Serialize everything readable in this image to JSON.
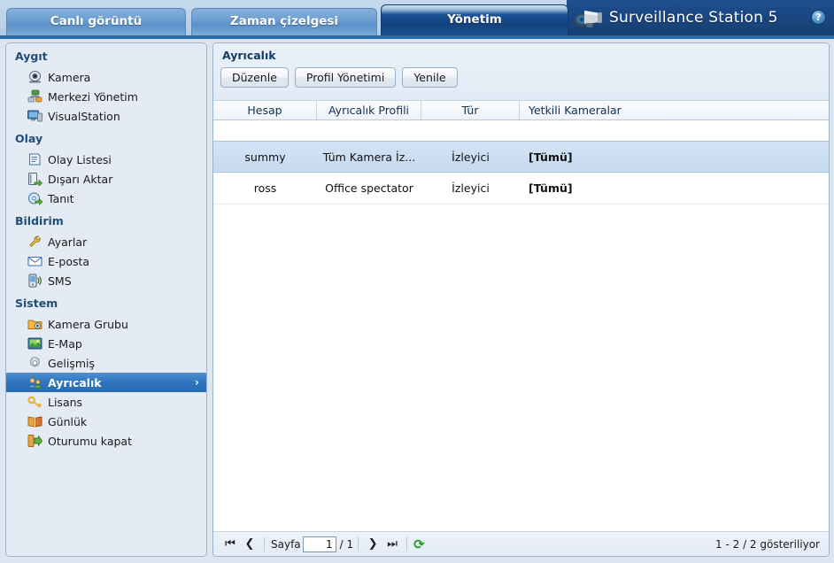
{
  "app": {
    "brand_title": "Surveillance Station 5",
    "help_glyph": "?",
    "logo_icon": "camera-logo-icon"
  },
  "tabs": [
    {
      "id": "live",
      "label": "Canlı görüntü",
      "active": false
    },
    {
      "id": "timeline",
      "label": "Zaman çizelgesi",
      "active": false
    },
    {
      "id": "admin",
      "label": "Yönetim",
      "active": true
    }
  ],
  "sidebar": {
    "groups": [
      {
        "title": "Aygıt",
        "items": [
          {
            "label": "Kamera",
            "icon": "camera-icon",
            "selected": false
          },
          {
            "label": "Merkezi Yönetim",
            "icon": "central-management-icon",
            "selected": false
          },
          {
            "label": "VisualStation",
            "icon": "visualstation-icon",
            "selected": false
          }
        ]
      },
      {
        "title": "Olay",
        "items": [
          {
            "label": "Olay Listesi",
            "icon": "event-list-icon",
            "selected": false
          },
          {
            "label": "Dışarı Aktar",
            "icon": "export-icon",
            "selected": false
          },
          {
            "label": "Tanıt",
            "icon": "mount-icon",
            "selected": false
          }
        ]
      },
      {
        "title": "Bildirim",
        "items": [
          {
            "label": "Ayarlar",
            "icon": "wrench-icon",
            "selected": false
          },
          {
            "label": "E-posta",
            "icon": "envelope-icon",
            "selected": false
          },
          {
            "label": "SMS",
            "icon": "sms-icon",
            "selected": false
          }
        ]
      },
      {
        "title": "Sistem",
        "items": [
          {
            "label": "Kamera Grubu",
            "icon": "camera-group-icon",
            "selected": false
          },
          {
            "label": "E-Map",
            "icon": "emap-icon",
            "selected": false
          },
          {
            "label": "Gelişmiş",
            "icon": "gear-icon",
            "selected": false
          },
          {
            "label": "Ayrıcalık",
            "icon": "privilege-icon",
            "selected": true,
            "arrow": "›"
          },
          {
            "label": "Lisans",
            "icon": "key-icon",
            "selected": false
          },
          {
            "label": "Günlük",
            "icon": "log-book-icon",
            "selected": false
          },
          {
            "label": "Oturumu kapat",
            "icon": "logout-icon",
            "selected": false
          }
        ]
      }
    ]
  },
  "main": {
    "title": "Ayrıcalık",
    "toolbar": [
      {
        "id": "edit",
        "label": "Düzenle"
      },
      {
        "id": "profile_manage",
        "label": "Profil Yönetimi"
      },
      {
        "id": "refresh",
        "label": "Yenile"
      }
    ],
    "table": {
      "columns": [
        "Hesap",
        "Ayrıcalık Profili",
        "Tür",
        "Yetkili Kameralar"
      ],
      "rows": [
        {
          "account": "summy",
          "profile": "Tüm Kamera İz...",
          "type": "İzleyici",
          "cameras": "[Tümü]",
          "selected": true
        },
        {
          "account": "ross",
          "profile": "Office spectator",
          "type": "İzleyici",
          "cameras": "[Tümü]",
          "selected": false
        }
      ]
    }
  },
  "pager": {
    "first_glyph": "⏮",
    "prev_glyph": "❮",
    "page_label": "Sayfa",
    "page_value": "1",
    "page_total": "/ 1",
    "next_glyph": "❯",
    "last_glyph": "⏭",
    "refresh_glyph": "⟳",
    "status": "1 - 2 / 2 gösteriliyor"
  },
  "colors": {
    "accent_blue": "#2f74bd",
    "brand_bar": "#1a4682",
    "selected_row": "#c6daf0",
    "refresh_green": "#1d9b28"
  }
}
